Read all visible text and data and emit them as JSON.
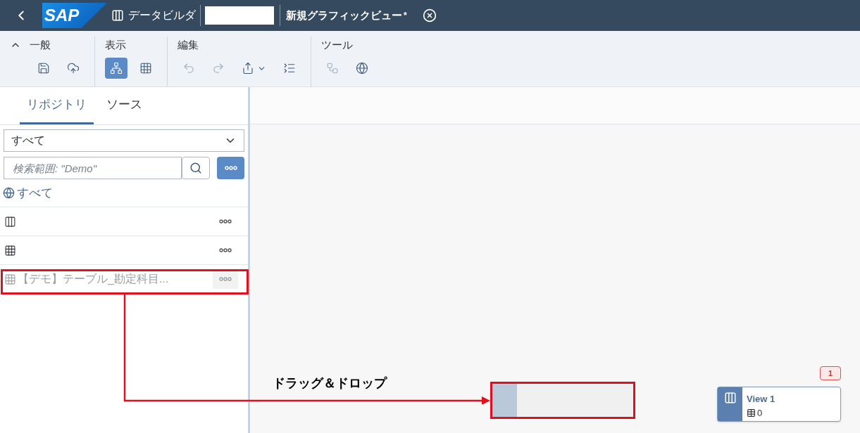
{
  "header": {
    "logo": "SAP",
    "app_title": "データビルダ",
    "view_title": "新規グラフィックビュー",
    "modified_mark": "*"
  },
  "toolbar": [
    {
      "title": "一般",
      "collapsible": true,
      "buttons": [
        {
          "kind": "save",
          "selected": false,
          "disabled": false
        },
        {
          "kind": "deploy",
          "selected": false,
          "disabled": false
        }
      ]
    },
    {
      "title": "表示",
      "collapsible": false,
      "buttons": [
        {
          "kind": "graph",
          "selected": true,
          "disabled": false
        },
        {
          "kind": "table",
          "selected": false,
          "disabled": false
        }
      ]
    },
    {
      "title": "編集",
      "collapsible": false,
      "buttons": [
        {
          "kind": "undo",
          "selected": false,
          "disabled": true
        },
        {
          "kind": "redo",
          "selected": false,
          "disabled": true
        },
        {
          "kind": "export",
          "selected": false,
          "disabled": false
        },
        {
          "kind": "outline",
          "selected": false,
          "disabled": false
        }
      ]
    },
    {
      "title": "ツール",
      "collapsible": false,
      "buttons": [
        {
          "kind": "tree",
          "selected": false,
          "disabled": true
        },
        {
          "kind": "network",
          "selected": false,
          "disabled": false
        }
      ]
    }
  ],
  "tabs": [
    {
      "label": "リポジトリ",
      "selected": true
    },
    {
      "label": "ソース",
      "selected": false
    }
  ],
  "filter": {
    "value": "すべて"
  },
  "search": {
    "placeholder": "検索範囲: \"Demo\""
  },
  "breadcrumb": "すべて",
  "items": [
    {
      "kind": "view",
      "dragging": false
    },
    {
      "kind": "table",
      "dragging": false
    },
    {
      "kind": "table",
      "label": "【デモ】テーブル_勘定科目...",
      "dragging": true
    }
  ],
  "annotation": {
    "label": "ドラッグ＆ドロップ"
  },
  "node": {
    "title": "View 1",
    "count": "0",
    "badge": "1"
  }
}
